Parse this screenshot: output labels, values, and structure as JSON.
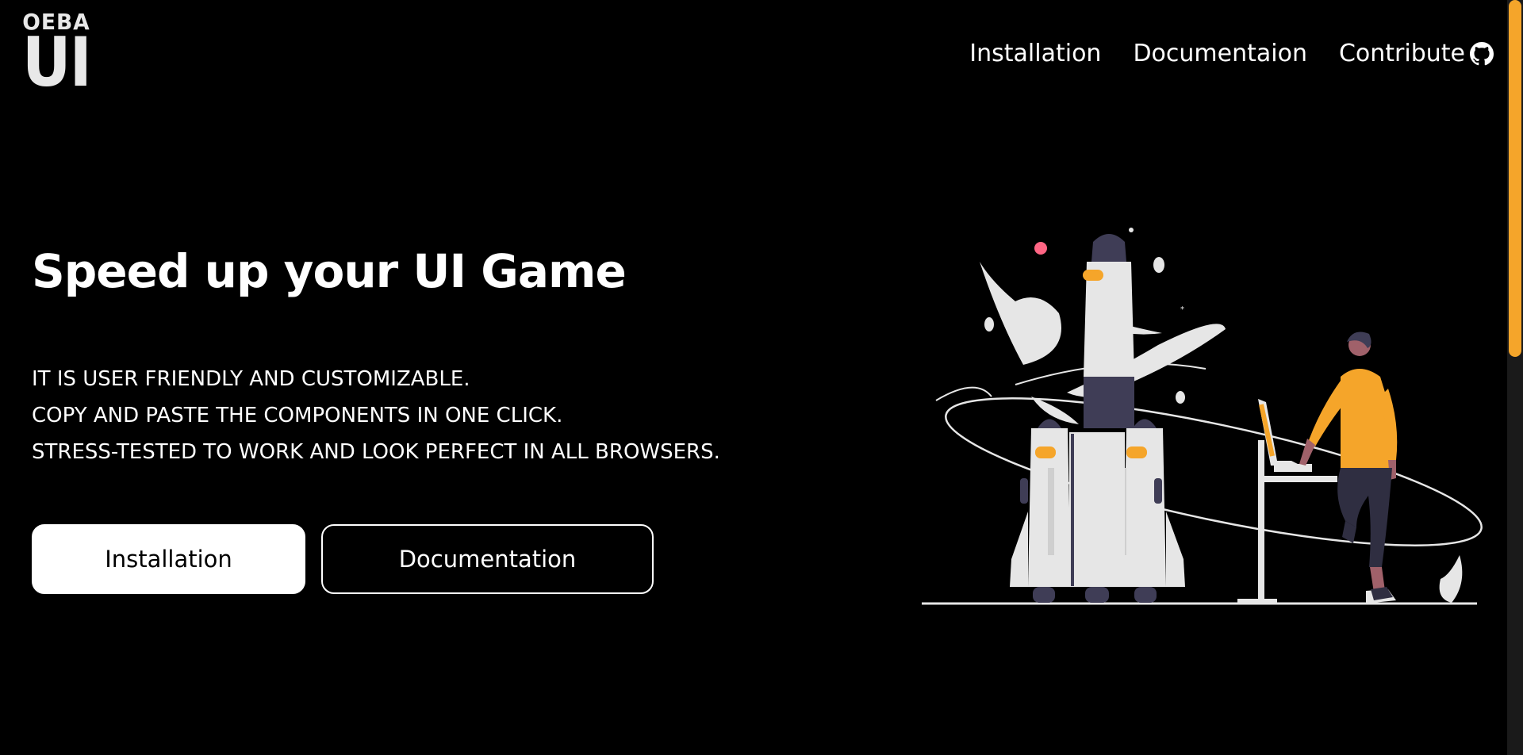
{
  "brand": {
    "logo_top": "OEBA",
    "logo_bottom": "UI"
  },
  "nav": {
    "items": [
      {
        "label": "Installation"
      },
      {
        "label": "Documentaion"
      },
      {
        "label": "Contribute",
        "icon": "github-icon"
      }
    ]
  },
  "hero": {
    "title": "Speed up your UI Game",
    "features": [
      "IT IS USER FRIENDLY AND CUSTOMIZABLE.",
      "COPY AND PASTE THE COMPONENTS IN ONE CLICK.",
      "STRESS-TESTED TO WORK AND LOOK PERFECT IN ALL BROWSERS."
    ],
    "primary_button": "Installation",
    "secondary_button": "Documentation"
  },
  "illustration": {
    "name": "rocket-launch-illustration"
  },
  "colors": {
    "background": "#000000",
    "text": "#ffffff",
    "accent": "#f5a52a",
    "rocket_body": "#e6e6e6",
    "dark_purple": "#3f3d56",
    "pink": "#ff6584"
  }
}
